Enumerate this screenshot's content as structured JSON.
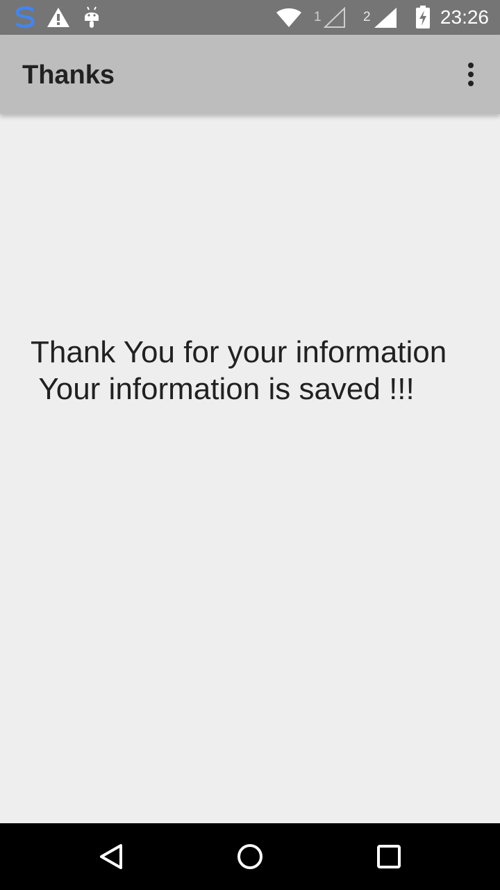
{
  "status_bar": {
    "time": "23:26",
    "sim1_label": "1",
    "sim2_label": "2",
    "icons": [
      "s-app-icon",
      "warning-icon",
      "android-debug-icon",
      "wifi-icon",
      "signal-sim1-icon",
      "signal-sim2-icon",
      "battery-charging-icon"
    ]
  },
  "app_bar": {
    "title": "Thanks",
    "overflow_icon": "more-vert-icon"
  },
  "main": {
    "message": "Thank You for your information\n Your information is saved !!!"
  },
  "nav_bar": {
    "icons": [
      "back-icon",
      "home-icon",
      "recents-icon"
    ]
  },
  "colors": {
    "status_bar": "#757575",
    "app_bar": "#bdbdbd",
    "background": "#eeeeee",
    "text": "#212121",
    "nav_bar": "#000000",
    "s_icon": "#4285f4"
  }
}
